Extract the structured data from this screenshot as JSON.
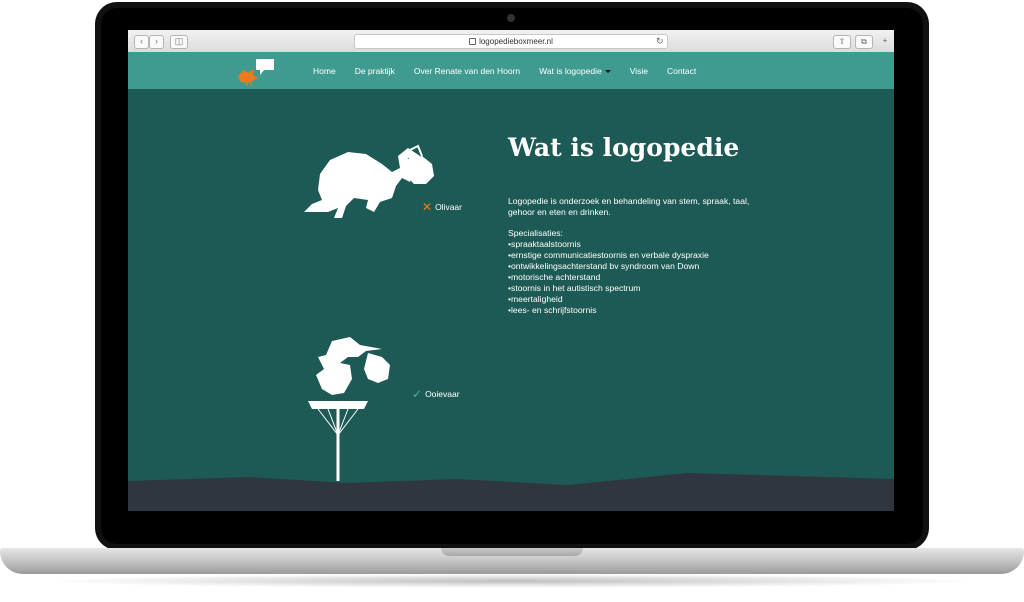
{
  "browser": {
    "url": "logopedieboxmeer.nl",
    "back_icon": "chevron-left-icon",
    "forward_icon": "chevron-right-icon",
    "sidebar_icon": "sidebar-icon",
    "share_icon": "share-icon",
    "tabs_icon": "tabs-icon",
    "new_tab_label": "+"
  },
  "nav": {
    "items": [
      {
        "label": "Home"
      },
      {
        "label": "De praktijk"
      },
      {
        "label": "Over Renate van den Hoorn"
      },
      {
        "label": "Wat is logopedie"
      },
      {
        "label": "Visie"
      },
      {
        "label": "Contact"
      }
    ],
    "logo_icon": "bird-speech-bubble-logo"
  },
  "main": {
    "title": "Wat is logopedie",
    "intro": "Logopedie is onderzoek en behandeling van stem, spraak, taal, gehoor en eten en drinken.",
    "spec_heading": "Specialisaties:",
    "specializations": [
      "spraaktaalstoornis",
      "ernstige communicatiestoornis en verbale dyspraxie",
      "ontwikkelingsachterstand bv syndroom van Down",
      "motorische achterstand",
      "stoornis in het autistisch spectrum",
      "meertaligheid",
      "lees- en schrijfstoornis"
    ],
    "elephant_label": "Olivaar",
    "stork_label": "Ooievaar"
  },
  "colors": {
    "nav_bg": "#3f9b90",
    "page_bg": "#1d5a55",
    "accent_orange": "#f07a1a",
    "ground": "#2f3640"
  }
}
